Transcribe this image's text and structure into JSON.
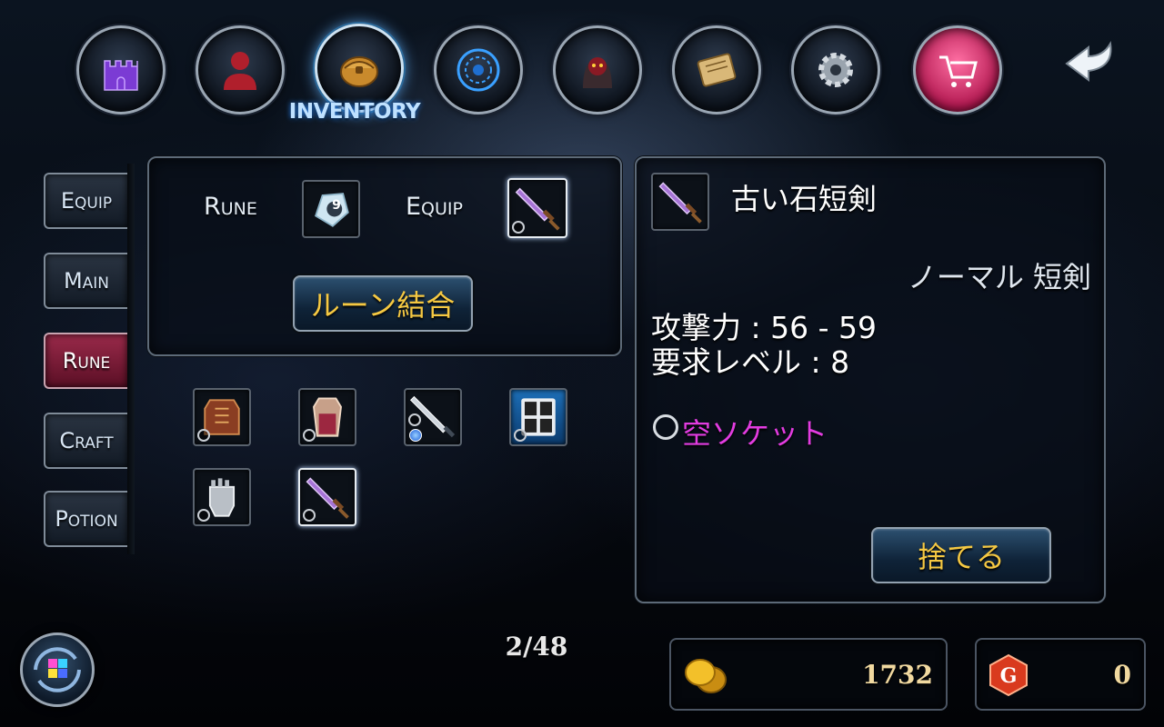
{
  "nav": {
    "buttons": [
      {
        "icon": "castle-icon"
      },
      {
        "icon": "character-icon"
      },
      {
        "icon": "bag-icon",
        "label": "INVENTORY"
      },
      {
        "icon": "magic-circle-icon"
      },
      {
        "icon": "monster-icon"
      },
      {
        "icon": "scroll-icon"
      },
      {
        "icon": "gear-icon"
      },
      {
        "icon": "cart-icon"
      }
    ],
    "active_label": "INVENTORY",
    "back_icon": "back-arrow-icon"
  },
  "tabs": [
    {
      "label": "Equip"
    },
    {
      "label": "Main"
    },
    {
      "label": "Rune",
      "active": true
    },
    {
      "label": "Craft"
    },
    {
      "label": "Potion"
    }
  ],
  "combine": {
    "rune_label": "Rune",
    "rune_number": "9",
    "equip_label": "Equip",
    "button_label": "ルーン結合"
  },
  "inventory": {
    "items": [
      {
        "icon": "armor-icon"
      },
      {
        "icon": "robe-icon"
      },
      {
        "icon": "sword-icon"
      },
      {
        "icon": "rune-tablet-icon"
      },
      {
        "icon": "gauntlet-icon"
      },
      {
        "icon": "purple-dagger-icon",
        "selected": true
      }
    ],
    "page": "2/48"
  },
  "detail": {
    "name": "古い石短剣",
    "rarity_type": "ノーマル 短剣",
    "attack": "攻撃力 : 56 - 59",
    "level": "要求レベル : 8",
    "socket": "空ソケット",
    "discard_label": "捨てる"
  },
  "currency": {
    "gold": "1732",
    "gems": "0"
  },
  "colors": {
    "gold_text": "#f5c842",
    "socket_text": "#e23ce0",
    "active_tab": "#9a2a4a",
    "shop_button": "#e0326f"
  }
}
